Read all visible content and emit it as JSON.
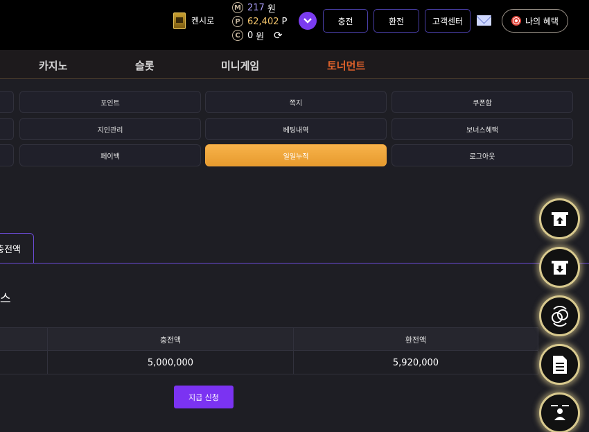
{
  "header": {
    "username": "켄시로",
    "balances": [
      {
        "symbol": "M",
        "value": "217",
        "unit": "원"
      },
      {
        "symbol": "P",
        "value": "62,402",
        "unit": "P"
      },
      {
        "symbol": "C",
        "value": "0",
        "unit": "원"
      }
    ],
    "buttons": {
      "deposit": "충전",
      "withdraw": "환전",
      "support": "고객센터",
      "benefits": "나의 혜택"
    },
    "icons": {
      "rank": "rank-badge-icon",
      "refresh": "refresh-icon",
      "expand": "chevron-down-icon",
      "mail": "mail-icon",
      "target": "target-icon"
    }
  },
  "nav": {
    "casino": "카지노",
    "slot": "슬롯",
    "mini": "미니게임",
    "tournament": "토너먼트"
  },
  "submenu": {
    "row1": [
      "포인트",
      "쪽지",
      "쿠폰함"
    ],
    "row2": [
      "지인관리",
      "베팅내역",
      "보너스혜택"
    ],
    "row3": [
      "페이백",
      "일일누적",
      "로그아웃"
    ],
    "active": "일일누적"
  },
  "tab": {
    "label": "충전액"
  },
  "section": {
    "glyph": "스"
  },
  "table": {
    "headers": [
      "충전액",
      "환전액"
    ],
    "rows": [
      {
        "deposit": "5,000,000",
        "withdraw": "5,920,000"
      }
    ]
  },
  "claim_button": "지급 신청",
  "colors": {
    "accent": "#7b33f2",
    "active_menu": "#f3a93d",
    "tournament": "#e0622b",
    "fab_ring": "#d8c98e"
  }
}
